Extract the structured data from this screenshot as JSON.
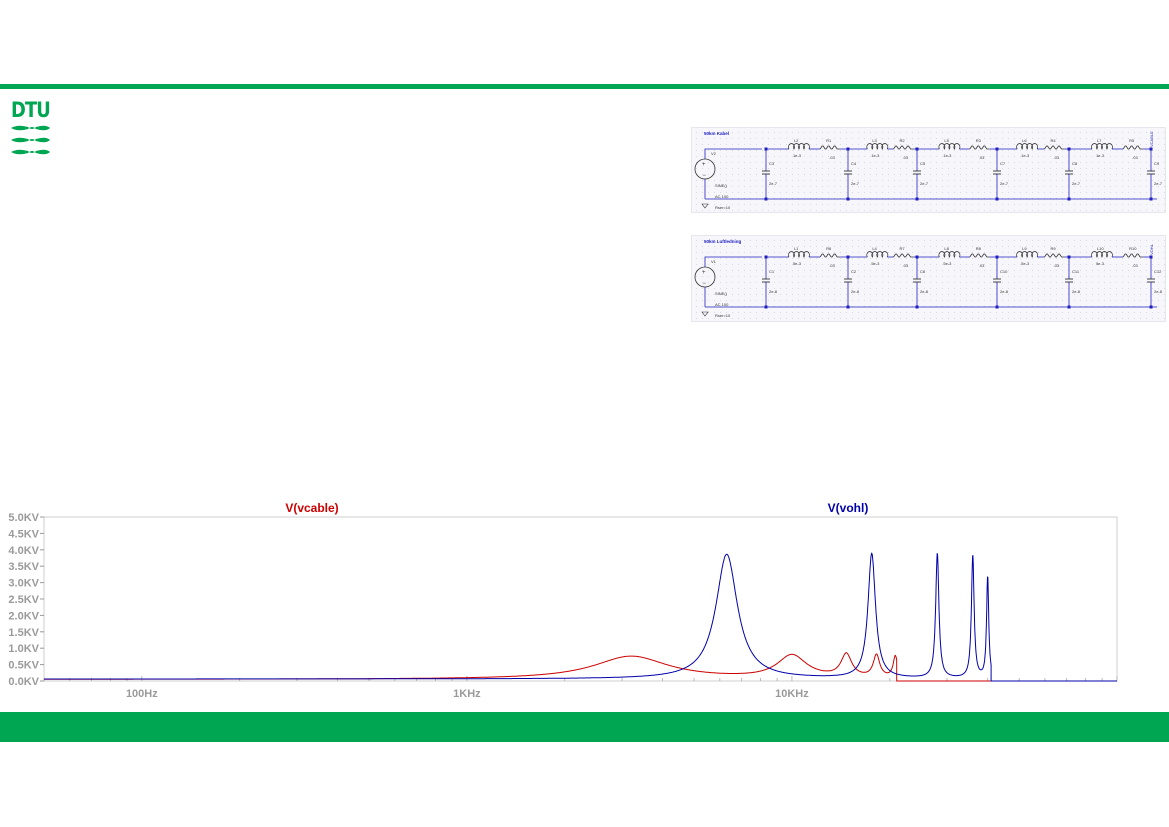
{
  "brand": {
    "logo_text": "DTU",
    "accent": "#00a651"
  },
  "schematics": [
    {
      "title": "50km Kabel",
      "source": {
        "ref": "V2",
        "func": "SINE()",
        "ac": "AC 100",
        "rser": "Rser=10"
      },
      "inductors": [
        {
          "ref": "L2",
          "value": "1e-3"
        },
        {
          "ref": "L3",
          "value": "1e-3"
        },
        {
          "ref": "L5",
          "value": "1e-3"
        },
        {
          "ref": "L6",
          "value": "1e-3"
        },
        {
          "ref": "L7",
          "value": "1e-3"
        }
      ],
      "resistors": [
        {
          "ref": "R1",
          "value": ".03"
        },
        {
          "ref": "R2",
          "value": ".03"
        },
        {
          "ref": "R3",
          "value": ".03"
        },
        {
          "ref": "R4",
          "value": ".03"
        },
        {
          "ref": "R5",
          "value": ".03"
        }
      ],
      "capacitors": [
        {
          "ref": "C3",
          "value": "2e-7"
        },
        {
          "ref": "C4",
          "value": "2e-7"
        },
        {
          "ref": "C5",
          "value": "2e-7"
        },
        {
          "ref": "C7",
          "value": "2e-7"
        },
        {
          "ref": "C8",
          "value": "2e-7"
        },
        {
          "ref": "C9",
          "value": "2e-7"
        }
      ],
      "net_label": "VCABLE"
    },
    {
      "title": "50km Luftledning",
      "source": {
        "ref": "V1",
        "func": "SINE()",
        "ac": "AC 100",
        "rser": "Rser=10"
      },
      "inductors": [
        {
          "ref": "L1",
          "value": "5e-3"
        },
        {
          "ref": "L4",
          "value": "5e-3"
        },
        {
          "ref": "L8",
          "value": "5e-3"
        },
        {
          "ref": "L9",
          "value": "5e-3"
        },
        {
          "ref": "L10",
          "value": "5e-3"
        }
      ],
      "resistors": [
        {
          "ref": "R6",
          "value": ".03"
        },
        {
          "ref": "R7",
          "value": ".03"
        },
        {
          "ref": "R8",
          "value": ".03"
        },
        {
          "ref": "R9",
          "value": ".03"
        },
        {
          "ref": "R10",
          "value": ".03"
        }
      ],
      "capacitors": [
        {
          "ref": "C1",
          "value": "2e-8"
        },
        {
          "ref": "C2",
          "value": "2e-8"
        },
        {
          "ref": "C6",
          "value": "2e-8"
        },
        {
          "ref": "C10",
          "value": "2e-8"
        },
        {
          "ref": "C11",
          "value": "2e-8"
        },
        {
          "ref": "C12",
          "value": "2e-8"
        }
      ],
      "net_label": "VOHL"
    }
  ],
  "chart_data": {
    "type": "line",
    "x_scale": "log",
    "xlim": [
      50,
      100000
    ],
    "ylim": [
      0,
      5000
    ],
    "grid": false,
    "y_ticks": [
      "0.0KV",
      "0.5KV",
      "1.0KV",
      "1.5KV",
      "2.0KV",
      "2.5KV",
      "3.0KV",
      "3.5KV",
      "4.0KV",
      "4.5KV",
      "5.0KV"
    ],
    "x_ticks": [
      {
        "value": 100,
        "label": "100Hz"
      },
      {
        "value": 1000,
        "label": "1KHz"
      },
      {
        "value": 10000,
        "label": "10KHz"
      }
    ],
    "series": [
      {
        "name": "V(vcable)",
        "color": "#cc0000",
        "baseline": 50,
        "peaks": [
          [
            3200,
            700,
            0.14
          ],
          [
            10000,
            700,
            0.055
          ],
          [
            14700,
            700,
            0.02
          ],
          [
            18200,
            680,
            0.012
          ],
          [
            20800,
            650,
            0.008
          ]
        ],
        "cutoff": 21000
      },
      {
        "name": "V(vohl)",
        "color": "#0000aa",
        "baseline": 60,
        "peaks": [
          [
            6300,
            3800,
            0.04
          ],
          [
            17600,
            3800,
            0.014
          ],
          [
            28000,
            3800,
            0.006
          ],
          [
            36000,
            3750,
            0.005
          ],
          [
            40000,
            3100,
            0.004
          ]
        ],
        "cutoff": 41000
      }
    ]
  }
}
